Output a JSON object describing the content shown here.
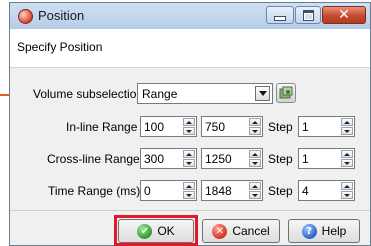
{
  "window": {
    "title": "Position",
    "subtitle": "Specify Position",
    "controls": {
      "minimize": "minimize-icon",
      "maximize": "maximize-icon",
      "close": "close-icon"
    }
  },
  "volume": {
    "label": "Volume subselection",
    "value": "Range"
  },
  "rows": [
    {
      "label": "In-line Range",
      "from": "100",
      "to": "750",
      "step_label": "Step",
      "step": "1"
    },
    {
      "label": "Cross-line Range",
      "from": "300",
      "to": "1250",
      "step_label": "Step",
      "step": "1"
    },
    {
      "label": "Time Range (ms)",
      "from": "0",
      "to": "1848",
      "step_label": "Step",
      "step": "4"
    }
  ],
  "buttons": {
    "ok": "OK",
    "cancel": "Cancel",
    "help": "Help"
  },
  "icons": {
    "ok": "check-icon",
    "cancel": "cancel-icon",
    "help": "help-icon",
    "volume_tool": "volume-tool-icon"
  },
  "colors": {
    "highlight": "#e2192c",
    "arrow": "#e0601e",
    "titlebar": "#c3d6ee"
  }
}
